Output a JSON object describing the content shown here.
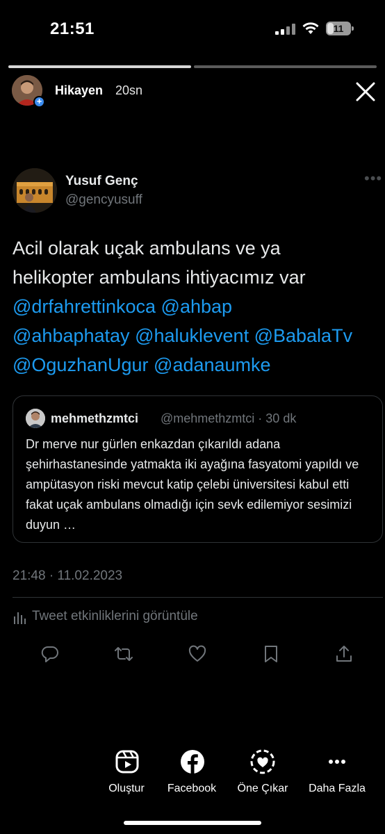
{
  "status_bar": {
    "time": "21:51",
    "battery_level": "11"
  },
  "story": {
    "progress_segments": [
      1.0,
      0.0
    ],
    "user_label": "Hikayen",
    "elapsed": "20sn"
  },
  "tweet": {
    "author_name": "Yusuf Genç",
    "author_handle": "@gencyusuff",
    "text_line1": "Acil olarak uçak ambulans ve ya",
    "text_line2": "helikopter ambulans ihtiyacımız var",
    "mentions": [
      "@drfahrettinkoca",
      "@ahbap",
      "@ahbaphatay",
      "@haluklevent",
      "@BabalaTv",
      "@OguzhanUgur",
      "@adanaumke"
    ],
    "timestamp": "21:48 · 11.02.2023",
    "activity_label": "Tweet etkinliklerini görüntüle"
  },
  "quote": {
    "author_name": "mehmethzmtci",
    "author_handle_time": "@mehmethzmtci · 30 dk",
    "text": "Dr merve nur gürlen enkazdan çıkarıldı adana şehirhastanesinde yatmakta iki ayağına fasyatomi yapıldı ve ampütasyon riski mevcut katip çelebi üniversitesi kabul etti fakat uçak ambulans olmadığı için sevk edilemiyor sesimizi duyun …"
  },
  "accent_colors": {
    "mention": "#1d9bf0",
    "muted_text": "#71767b",
    "border": "#2f3336"
  },
  "bottom_actions": [
    {
      "label": "Oluştur",
      "icon": "create-icon"
    },
    {
      "label": "Facebook",
      "icon": "facebook-icon"
    },
    {
      "label": "Öne Çıkar",
      "icon": "highlight-heart-icon"
    },
    {
      "label": "Daha Fazla",
      "icon": "more-icon"
    }
  ]
}
